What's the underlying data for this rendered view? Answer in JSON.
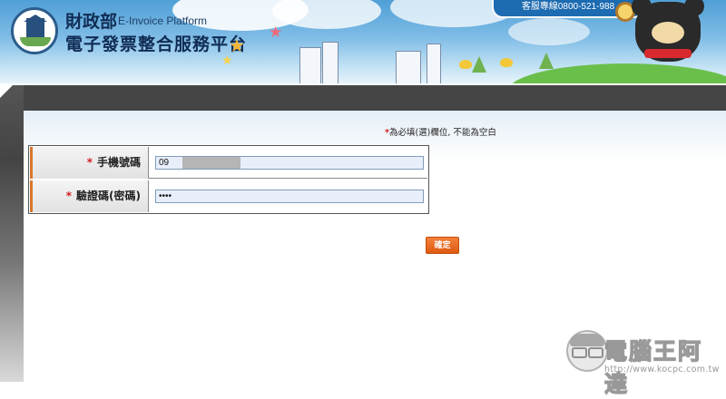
{
  "header": {
    "ministry": "財政部",
    "platform_en": "E-Invoice Platform",
    "platform_zh": "電子發票整合服務平台",
    "hotline": "客服專線0800-521-988",
    "icons": [
      "ministry-seal-logo",
      "mascot-bear",
      "star",
      "bird",
      "building"
    ]
  },
  "form": {
    "required_note_mark": "*",
    "required_note": "為必填(選)欄位, 不能為空白",
    "fields": [
      {
        "required_mark": "*",
        "label": "手機號碼",
        "value": "09",
        "masked": true
      },
      {
        "required_mark": "*",
        "label": "驗證碼(密碼)",
        "value": "••••"
      }
    ],
    "submit_label": "確定"
  },
  "watermark": {
    "title": "電腦王阿達",
    "url": "http://www.kocpc.com.tw"
  },
  "colors": {
    "banner": "#4f9fd6",
    "hotline_bg": "#1d6bb1",
    "frame_dark": "#454545",
    "label_accent": "#d9772b",
    "required": "#d21f1f",
    "submit_bg": "#e8681f",
    "input_bg": "#e8effb"
  }
}
